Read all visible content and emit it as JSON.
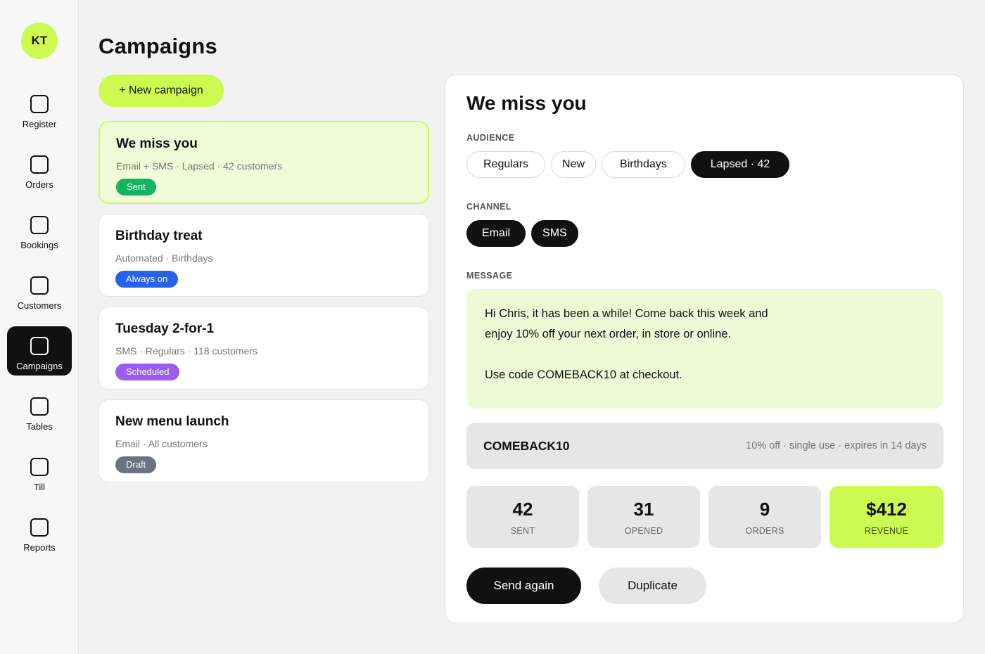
{
  "user": {
    "initials": "KT"
  },
  "nav": {
    "items": [
      {
        "label": "Register",
        "icon": "register-icon"
      },
      {
        "label": "Orders",
        "icon": "orders-icon"
      },
      {
        "label": "Bookings",
        "icon": "bookings-icon"
      },
      {
        "label": "Customers",
        "icon": "customers-icon"
      },
      {
        "label": "Campaigns",
        "icon": "campaigns-icon",
        "active": true
      },
      {
        "label": "Tables",
        "icon": "tables-icon"
      },
      {
        "label": "Till",
        "icon": "till-icon"
      },
      {
        "label": "Reports",
        "icon": "reports-icon"
      }
    ]
  },
  "page": {
    "title": "Campaigns",
    "new_button": "+ New campaign"
  },
  "campaigns": [
    {
      "name": "We miss you",
      "meta": "Email + SMS · Lapsed · 42 customers",
      "status": "Sent",
      "status_color": "#16b364",
      "selected": true
    },
    {
      "name": "Birthday treat",
      "meta": "Automated · Birthdays",
      "status": "Always on",
      "status_color": "#2563eb"
    },
    {
      "name": "Tuesday 2-for-1",
      "meta": "SMS · Regulars · 118 customers",
      "status": "Scheduled",
      "status_color": "#9b5cf0"
    },
    {
      "name": "New menu launch",
      "meta": "Email · All customers",
      "status": "Draft",
      "status_color": "#6b7280"
    }
  ],
  "detail": {
    "title": "We miss you",
    "audience_label": "AUDIENCE",
    "audience": [
      {
        "label": "Regulars",
        "selected": false
      },
      {
        "label": "New",
        "selected": false
      },
      {
        "label": "Birthdays",
        "selected": false
      },
      {
        "label": "Lapsed · 42",
        "selected": true
      }
    ],
    "channel_label": "CHANNEL",
    "channels": [
      {
        "label": "Email",
        "selected": true
      },
      {
        "label": "SMS",
        "selected": true
      }
    ],
    "message_label": "MESSAGE",
    "message": "Hi Chris, it has been a while! Come back this week and\nenjoy 10% off your next order, in store or online.\n\nUse code COMEBACK10 at checkout.",
    "code": "COMEBACK10",
    "code_desc": "10% off · single use · expires in 14 days",
    "stats": [
      {
        "value": "42",
        "label": "SENT"
      },
      {
        "value": "31",
        "label": "OPENED"
      },
      {
        "value": "9",
        "label": "ORDERS"
      },
      {
        "value": "$412",
        "label": "REVENUE",
        "highlight": true
      }
    ],
    "send_again": "Send again",
    "duplicate": "Duplicate"
  },
  "colors": {
    "accent": "#cdfa50",
    "selected_card_bg": "#f1fad9",
    "dark": "#111111"
  }
}
